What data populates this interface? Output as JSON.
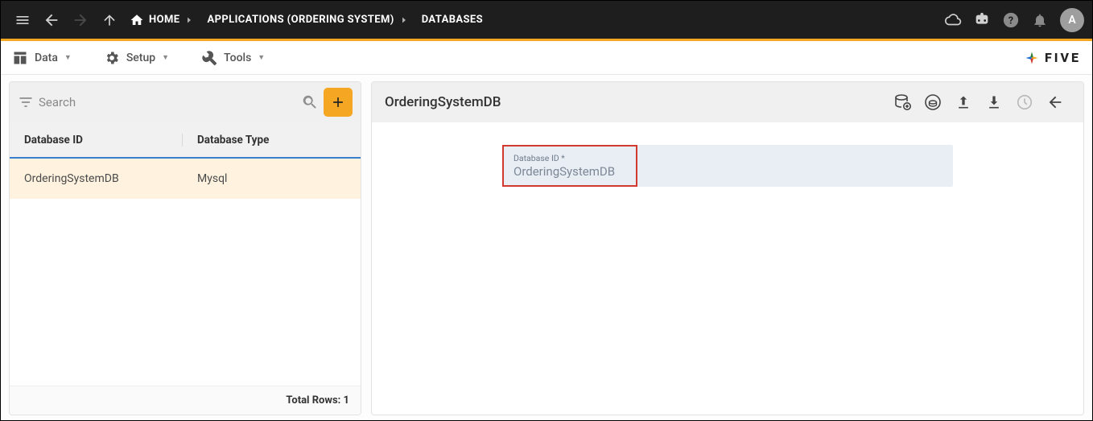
{
  "topbar": {
    "home_label": "HOME",
    "crumb_app": "APPLICATIONS (ORDERING SYSTEM)",
    "crumb_db": "DATABASES",
    "avatar_letter": "A"
  },
  "menubar": {
    "data": "Data",
    "setup": "Setup",
    "tools": "Tools",
    "brand": "FIVE"
  },
  "left": {
    "search_placeholder": "Search",
    "col_database_id": "Database ID",
    "col_database_type": "Database Type",
    "rows": [
      {
        "id": "OrderingSystemDB",
        "type": "Mysql"
      }
    ],
    "footer_label": "Total Rows:",
    "footer_count": "1"
  },
  "detail": {
    "title": "OrderingSystemDB",
    "field_label": "Database ID *",
    "field_value": "OrderingSystemDB"
  }
}
